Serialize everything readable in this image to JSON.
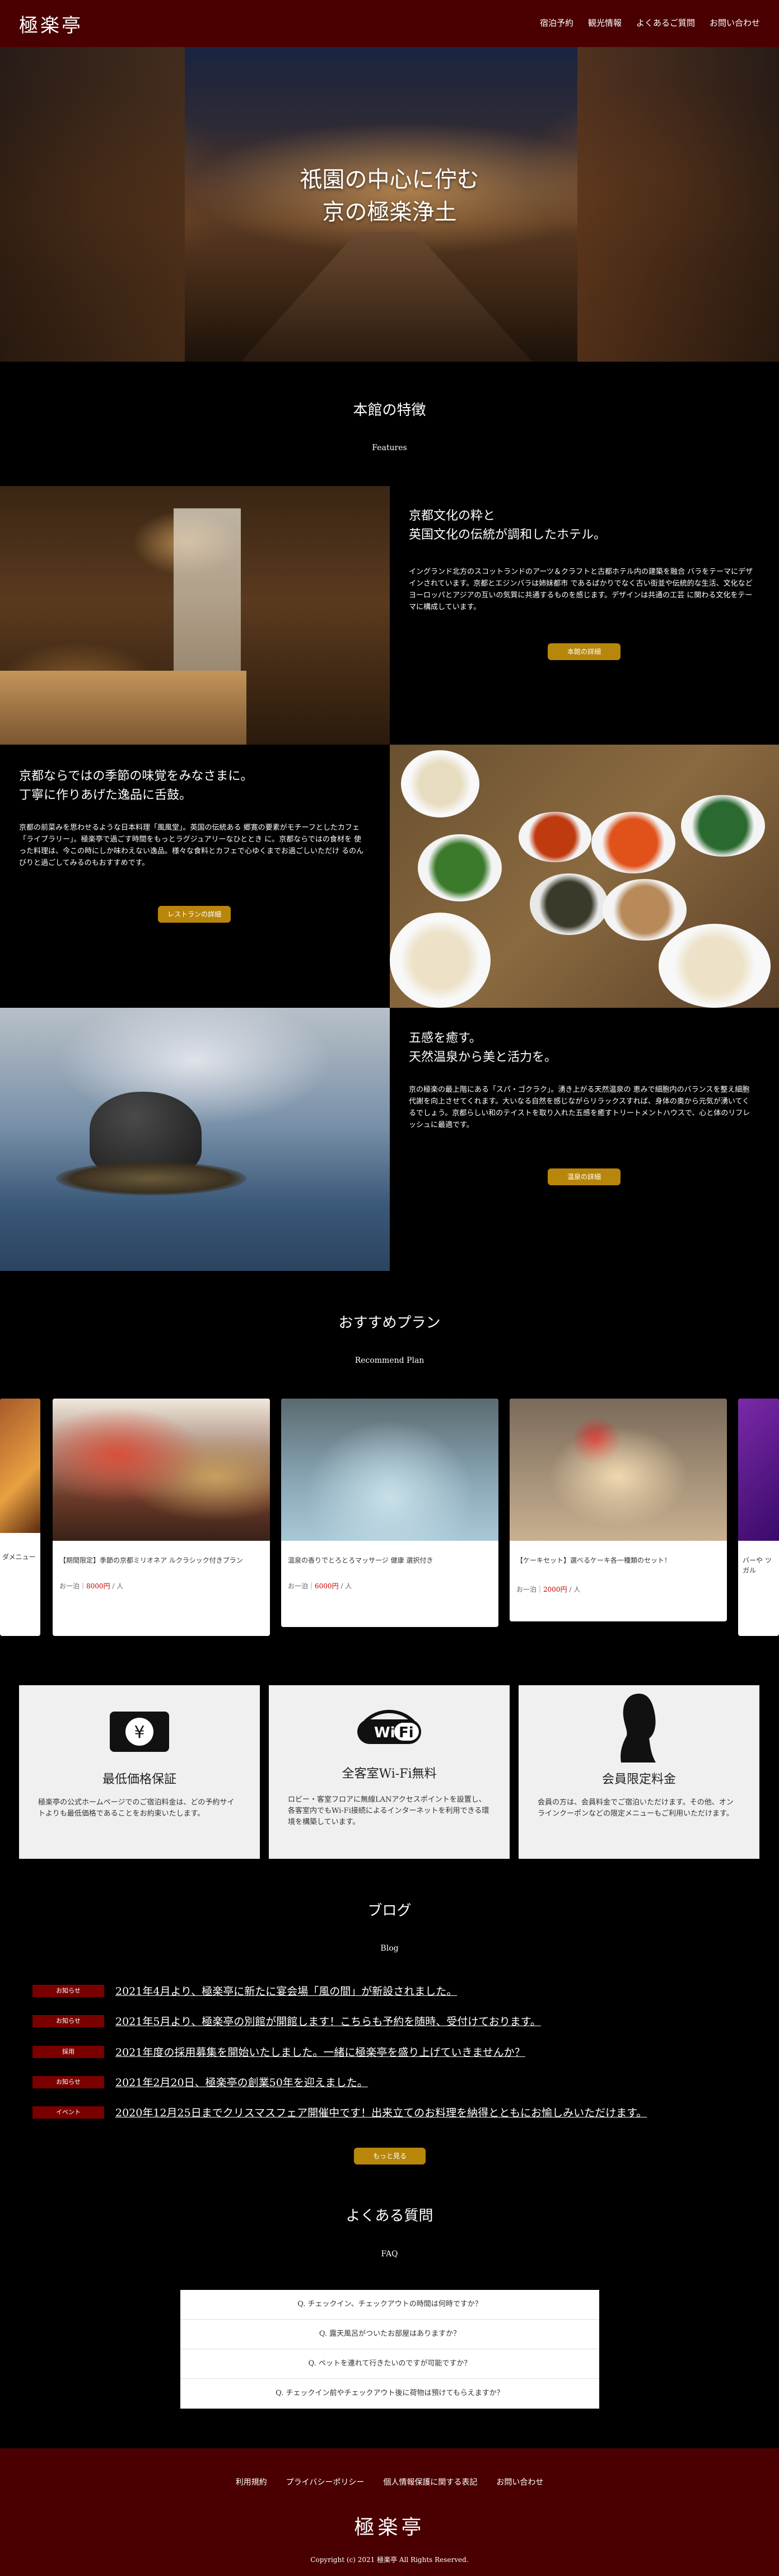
{
  "header": {
    "logo": "極楽亭",
    "nav": [
      "宿泊予約",
      "観光情報",
      "よくあるご質問",
      "お問い合わせ"
    ]
  },
  "hero": {
    "line1": "祇園の中心に佇む",
    "line2": "京の極楽浄土"
  },
  "features_section": {
    "title": "本館の特徴",
    "subtitle": "Features",
    "items": [
      {
        "title1": "京都文化の粋と",
        "title2": "英国文化の伝統が調和したホテル。",
        "body": "イングランド北方のスコットランドのアーツ＆クラフトと古都ホテル内の建築を融合 バラをテーマにデザインされています。京都とエジンバラは姉妹都市 であるばかりでなく古い街並や伝統的な生活、文化などヨーロッパとアジアの互いの気質に共通するものを感じます。デザインは共通の工芸 に関わる文化をテーマに構成しています。",
        "button": "本館の詳細"
      },
      {
        "title1": "京都ならではの季節の味覚をみなさまに。",
        "title2": "丁寧に作りあげた逸品に舌鼓。",
        "body": "京都の前菜みを思わせるような日本料理「風風堂」。英国の伝統ある 郷寛の要素がモチーフとしたカフェ「ライブラリー」。極楽亭で過ごす時間をもっとラグジュアリーなひととき に。京都ならではの食材を 使った料理は、今この時にしか味わえない逸品。様々な食料とカフェで心ゆくまでお過ごしいただけ るのんびりと過ごしてみるのもおすすめです。",
        "button": "レストランの詳細"
      },
      {
        "title1": "五感を癒す。",
        "title2": "天然温泉から美と活力を。",
        "body": "京の極楽の最上階にある「スパ・ゴクラク」。湧き上がる天然温泉の 恵みで細胞内のバランスを整え細胞代謝を向上させてくれます。大いなる自然を感じながらリラックスすれば、身体の奥から元気が湧いてくるでしょう。京都らしい和のテイストを取り入れた五感を癒すトリートメントハウスで、心と体のリフレッシュに最適です。",
        "button": "温泉の詳細"
      }
    ]
  },
  "plans_section": {
    "title": "おすすめプラン",
    "subtitle": "Recommend Plan",
    "cards": [
      {
        "text": "【期間限定】季節の京都ミリオネア ルクラシック付きプラン",
        "price_label": "お一泊",
        "price": "8000円",
        "unit": "/ 人"
      },
      {
        "text": "温泉の香りでとろとろマッサージ 健康 選択付き",
        "price_label": "お一泊",
        "price": "6000円",
        "unit": "/ 人"
      },
      {
        "text": "【ケーキセット】選べるケーキ各一種類のセット！",
        "price_label": "お一泊",
        "price": "2000円",
        "unit": "/ 人"
      }
    ],
    "left_partial_text": "ダメニュー",
    "right_partial_text": "バーや ツガル"
  },
  "service_boxes": [
    {
      "icon": "yen-bill-icon",
      "title": "最低価格保証",
      "text": "極楽亭の公式ホームページでのご宿泊料金は、どの予約サイトよりも最低価格であることをお約束いたします。"
    },
    {
      "icon": "wifi-icon",
      "title": "全客室Wi-Fi無料",
      "text": "ロビー・客室フロアに無線LANアクセスポイントを設置し、各客室内でもWi-Fi接続によるインターネットを利用できる環境を構築しています。"
    },
    {
      "icon": "member-silhouette-icon",
      "title": "会員限定料金",
      "text": "会員の方は、会員料金でご宿泊いただけます。その他、オンラインクーポンなどの限定メニューもご利用いただけます。"
    }
  ],
  "blog_section": {
    "title": "ブログ",
    "subtitle": "Blog",
    "items": [
      {
        "tag": "お知らせ",
        "text": "2021年4月より、極楽亭に新たに宴会場「風の間」が新設されました。"
      },
      {
        "tag": "お知らせ",
        "text": "2021年5月より、極楽亭の別館が開館します！こちらも予約を随時、受付けております。"
      },
      {
        "tag": "採用",
        "text": "2021年度の採用募集を開始いたしました。一緒に極楽亭を盛り上げていきませんか？"
      },
      {
        "tag": "お知らせ",
        "text": "2021年2月20日、極楽亭の創業50年を迎えました。"
      },
      {
        "tag": "イベント",
        "text": "2020年12月25日までクリスマスフェア開催中です！出来立てのお料理を納得とともにお愉しみいただけます。"
      }
    ],
    "button": "もっと見る"
  },
  "faq_section": {
    "title": "よくある質問",
    "subtitle": "FAQ",
    "items": [
      "Q. チェックイン、チェックアウトの時間は何時ですか？",
      "Q. 露天風呂がついたお部屋はありますか？",
      "Q. ペットを連れて行きたいのですが可能ですか？",
      "Q. チェックイン前やチェックアウト後に荷物は預けてもらえますか？"
    ]
  },
  "footer": {
    "links": [
      "利用規約",
      "プライバシーポリシー",
      "個人情報保護に関する表記",
      "お問い合わせ"
    ],
    "logo": "極楽亭",
    "copyright": "Copyright (c) 2021 極楽亭 All Rights Reserved."
  },
  "colors": {
    "header_bg": "#4a0000",
    "accent_gold": "#b8860b",
    "tag_red": "#7a0000"
  }
}
